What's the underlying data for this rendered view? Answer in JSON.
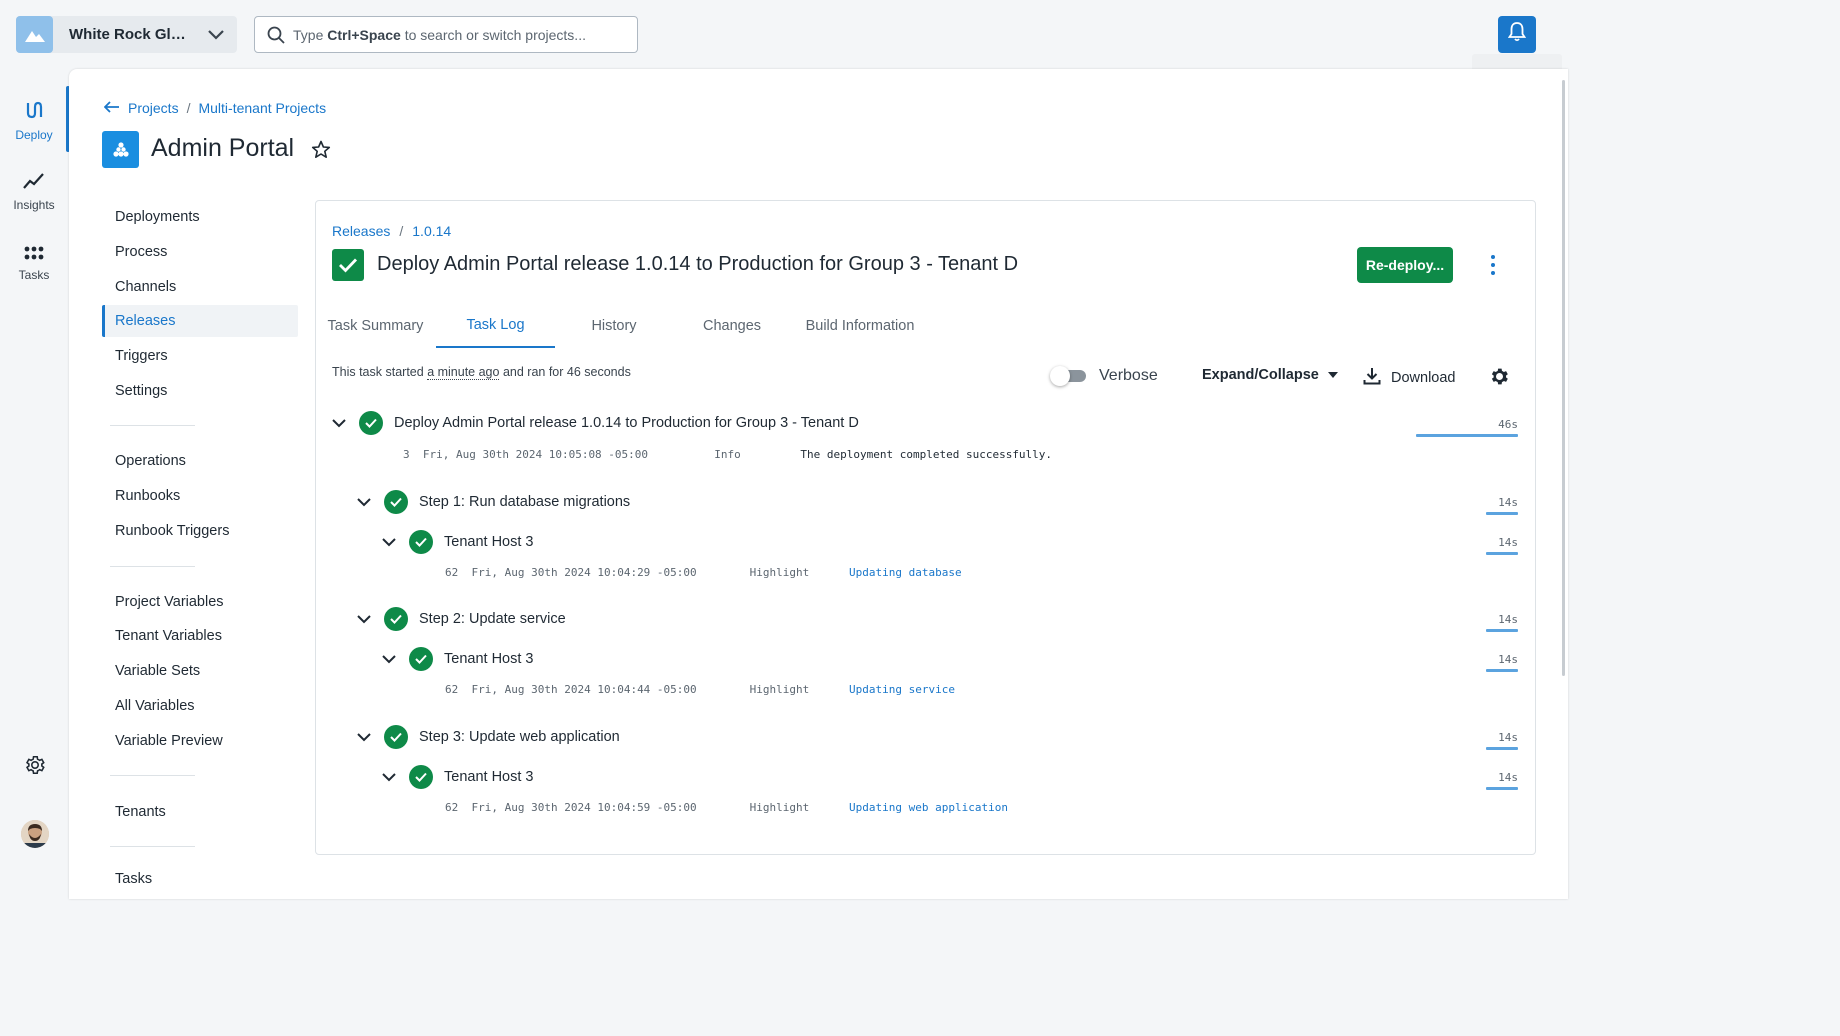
{
  "org": {
    "name": "White Rock Global"
  },
  "search": {
    "prefix": "Type",
    "shortcut": "Ctrl+Space",
    "suffix": "to search or switch projects..."
  },
  "rail": [
    {
      "label": "Deploy",
      "icon": "deploy-icon"
    },
    {
      "label": "Insights",
      "icon": "insights-icon"
    },
    {
      "label": "Tasks",
      "icon": "tasks-icon"
    }
  ],
  "breadcrumb": {
    "projects": "Projects",
    "group": "Multi-tenant Projects"
  },
  "project": {
    "title": "Admin Portal"
  },
  "project_nav": {
    "group1": [
      "Deployments",
      "Process",
      "Channels",
      "Releases",
      "Triggers",
      "Settings"
    ],
    "group2": [
      "Operations",
      "Runbooks",
      "Runbook Triggers"
    ],
    "group3": [
      "Project Variables",
      "Tenant Variables",
      "Variable Sets",
      "All Variables",
      "Variable Preview"
    ],
    "group4": [
      "Tenants"
    ],
    "group5": [
      "Tasks"
    ],
    "active": "Releases"
  },
  "task": {
    "crumb_releases": "Releases",
    "crumb_version": "1.0.14",
    "title": "Deploy Admin Portal release 1.0.14 to Production for Group 3 - Tenant D",
    "redeploy_label": "Re-deploy...",
    "tabs": [
      "Task Summary",
      "Task Log",
      "History",
      "Changes",
      "Build Information"
    ],
    "active_tab": "Task Log",
    "started_prefix": "This task started",
    "started_when": "a minute ago",
    "started_suffix": "and ran for 46 seconds",
    "verbose_label": "Verbose",
    "verbose_on": false,
    "expand_label": "Expand/Collapse",
    "download_label": "Download"
  },
  "log": {
    "root": {
      "title": "Deploy Admin Portal release 1.0.14 to Production for Group 3 - Tenant D",
      "duration": "46s",
      "line": {
        "num": "3",
        "time": "Fri, Aug 30th 2024 10:05:08 -05:00",
        "level": "Info",
        "message": "The deployment completed successfully."
      }
    },
    "steps": [
      {
        "title": "Step 1: Run database migrations",
        "duration": "14s",
        "host": {
          "title": "Tenant Host 3",
          "duration": "14s",
          "line": {
            "num": "62",
            "time": "Fri, Aug 30th 2024 10:04:29 -05:00",
            "level": "Highlight",
            "message": "Updating database"
          }
        }
      },
      {
        "title": "Step 2: Update service",
        "duration": "14s",
        "host": {
          "title": "Tenant Host 3",
          "duration": "14s",
          "line": {
            "num": "62",
            "time": "Fri, Aug 30th 2024 10:04:44 -05:00",
            "level": "Highlight",
            "message": "Updating service"
          }
        }
      },
      {
        "title": "Step 3: Update web application",
        "duration": "14s",
        "host": {
          "title": "Tenant Host 3",
          "duration": "14s",
          "line": {
            "num": "62",
            "time": "Fri, Aug 30th 2024 10:04:59 -05:00",
            "level": "Highlight",
            "message": "Updating web application"
          }
        }
      }
    ]
  },
  "colors": {
    "accent": "#1a77ca",
    "success": "#0e8a48",
    "muted": "#5c6670"
  }
}
